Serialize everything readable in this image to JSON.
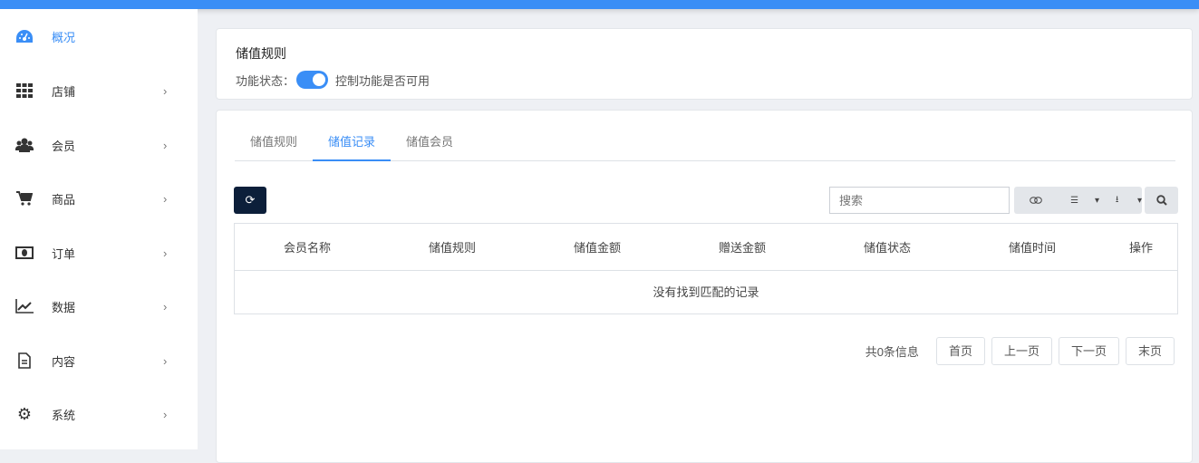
{
  "sidebar": {
    "items": [
      {
        "label": "概况",
        "icon": "dashboard-icon"
      },
      {
        "label": "店铺",
        "icon": "grid-icon"
      },
      {
        "label": "会员",
        "icon": "users-icon"
      },
      {
        "label": "商品",
        "icon": "cart-icon"
      },
      {
        "label": "订单",
        "icon": "money-icon"
      },
      {
        "label": "数据",
        "icon": "chart-icon"
      },
      {
        "label": "内容",
        "icon": "document-icon"
      },
      {
        "label": "系统",
        "icon": "gear-icon"
      }
    ]
  },
  "rule_card": {
    "title": "储值规则",
    "state_label": "功能状态：",
    "state_on": true,
    "state_desc": "控制功能是否可用"
  },
  "tabs": [
    "储值规则",
    "储值记录",
    "储值会员"
  ],
  "toolbar": {
    "search_placeholder": "搜索"
  },
  "table": {
    "columns": [
      "会员名称",
      "储值规则",
      "储值金额",
      "赠送金额",
      "储值状态",
      "储值时间",
      "操作"
    ],
    "empty": "没有找到匹配的记录"
  },
  "pager": {
    "info": "共0条信息",
    "first": "首页",
    "prev": "上一页",
    "next": "下一页",
    "last": "末页"
  },
  "colors": {
    "accent": "#3a8ef6",
    "refresh": "#0c1f3a"
  }
}
